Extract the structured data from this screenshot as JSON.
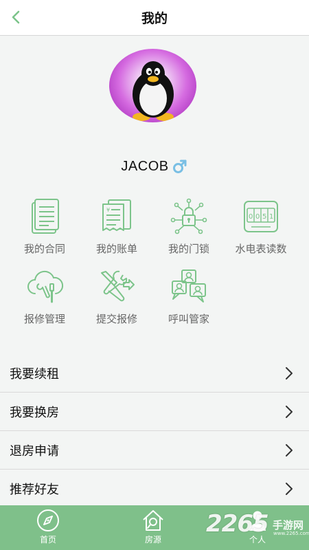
{
  "header": {
    "title": "我的",
    "back_icon": "chevron-left-icon"
  },
  "profile": {
    "name": "JACOB",
    "gender_icon": "male-icon",
    "avatar": "penguin-avatar"
  },
  "grid": [
    {
      "label": "我的合同",
      "icon": "contract-icon"
    },
    {
      "label": "我的账单",
      "icon": "bill-icon"
    },
    {
      "label": "我的门锁",
      "icon": "smart-lock-icon"
    },
    {
      "label": "水电表读数",
      "icon": "meter-icon"
    },
    {
      "label": "报修管理",
      "icon": "repair-cloud-icon"
    },
    {
      "label": "提交报修",
      "icon": "tools-icon"
    },
    {
      "label": "呼叫管家",
      "icon": "call-butler-icon"
    }
  ],
  "menu": [
    {
      "label": "我要续租"
    },
    {
      "label": "我要换房"
    },
    {
      "label": "退房申请"
    },
    {
      "label": "推荐好友"
    }
  ],
  "tabs": [
    {
      "label": "首页",
      "icon": "compass-icon"
    },
    {
      "label": "房源",
      "icon": "house-search-icon"
    },
    {
      "label": "个人",
      "icon": "person-icon"
    }
  ],
  "watermark": {
    "number": "2265",
    "text": "手游网",
    "url": "www.2265.com"
  },
  "colors": {
    "accent": "#7fc08a",
    "icon_green": "#7cc48a",
    "arrow": "#333333"
  }
}
